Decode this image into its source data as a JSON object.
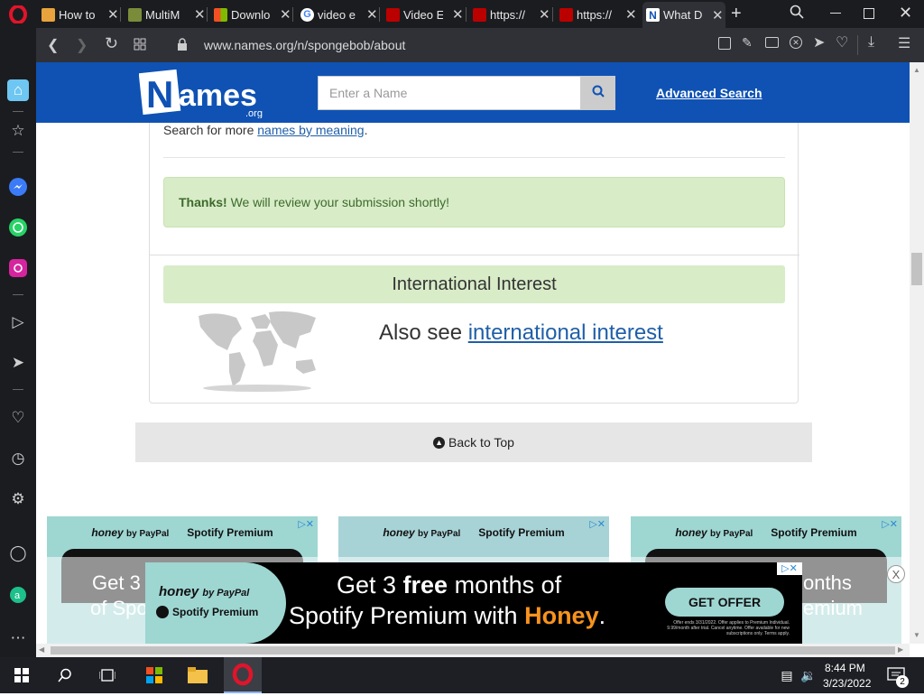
{
  "browser": {
    "tabs": [
      {
        "title": "How to",
        "favicon": "mc-icon",
        "color": "#e8a33c"
      },
      {
        "title": "MultiM",
        "favicon": "multimc-icon",
        "color": "#7a8c3a"
      },
      {
        "title": "Downlo",
        "favicon": "windows-icon",
        "color": "#00a4ef"
      },
      {
        "title": "video e",
        "favicon": "google-icon",
        "color": "#4285f4"
      },
      {
        "title": "Video E",
        "favicon": "nch-icon",
        "color": "#b00"
      },
      {
        "title": "https://",
        "favicon": "nch-icon",
        "color": "#b00"
      },
      {
        "title": "https://",
        "favicon": "nch-icon",
        "color": "#b00"
      },
      {
        "title": "What D",
        "favicon": "names-icon",
        "color": "#0f52b4"
      }
    ],
    "url": "www.names.org/n/spongebob/about"
  },
  "site": {
    "logo": "Names",
    "logo_suffix": ".org",
    "search_placeholder": "Enter a Name",
    "advanced_search": "Advanced Search"
  },
  "content": {
    "search_more_prefix": "Search for more ",
    "search_more_link": "names by meaning",
    "search_more_suffix": ".",
    "thanks_bold": "Thanks!",
    "thanks_text": " We will review your submission shortly!",
    "intl_heading": "International Interest",
    "also_see_prefix": "Also see ",
    "also_see_link": "international interest",
    "back_to_top": "Back to Top"
  },
  "ads": {
    "honey_brand": "honey",
    "by_paypal": "by PayPal",
    "spotify": "Spotify Premium",
    "headline_1a": "Get 3 ",
    "headline_1b": "free",
    "headline_1c": " months of",
    "headline_2a": "Spotify Premium with ",
    "headline_2b": "Honey",
    "headline_2c": ".",
    "cta": "GET OFFER",
    "fine_print": "Offer ends 3/31/2022. Offer applies to Premium Individual. 9.99/month after trial. Cancel anytime. Offer available for new subscriptions only. Terms apply.",
    "bg_partial_1": "Get 3",
    "bg_partial_2": "of Spo",
    "bg_partial_3": "onths",
    "bg_partial_4": "emium",
    "close": "X"
  },
  "taskbar": {
    "time": "8:44 PM",
    "date": "3/23/2022",
    "notifications": "2"
  },
  "colors": {
    "brand_blue": "#0f52b4",
    "alert_green": "#d8ecc8",
    "ad_teal": "#9ed6d2",
    "honey_orange": "#f7931e"
  }
}
